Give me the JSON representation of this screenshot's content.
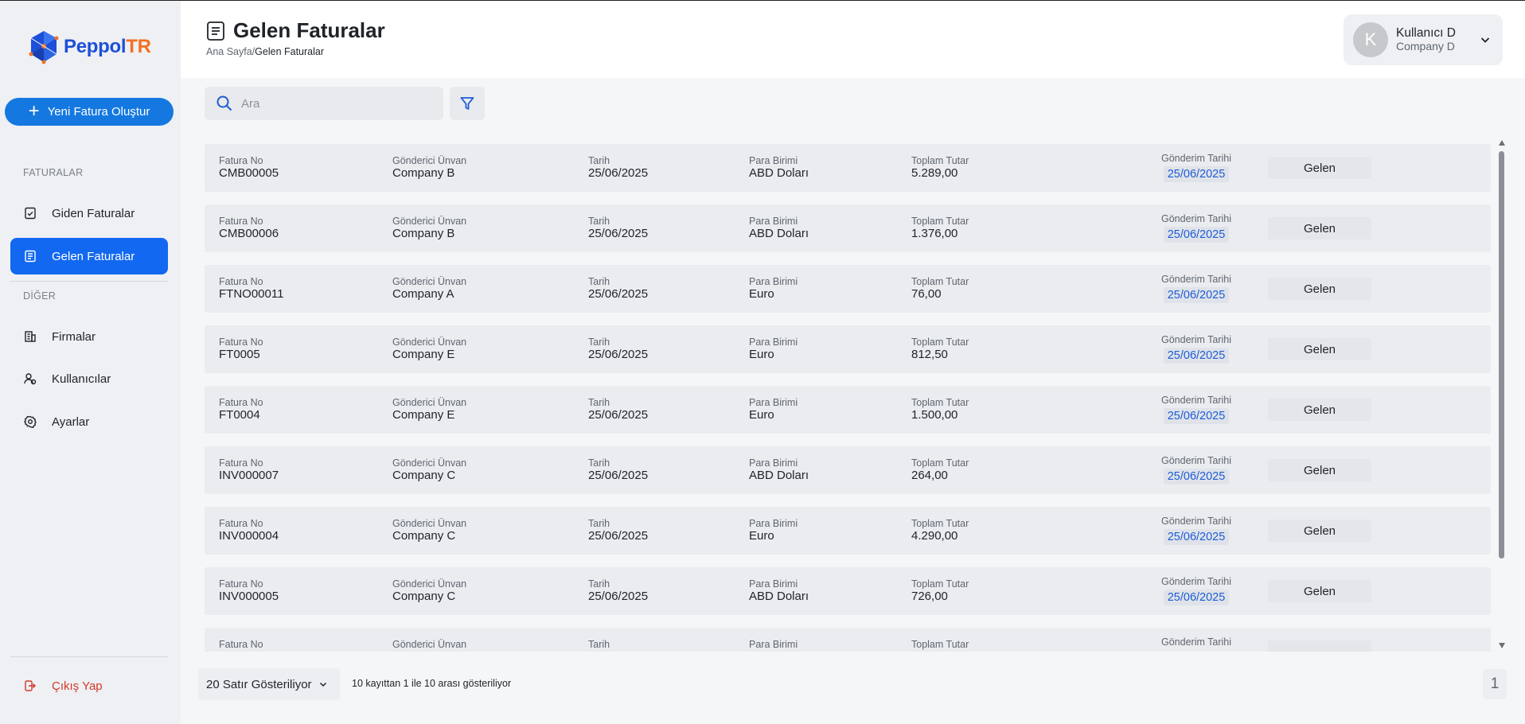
{
  "brand": {
    "part1": "Peppol",
    "part2": "TR",
    "color_blue": "#1d4fd8",
    "color_orange": "#f37021"
  },
  "sidebar": {
    "new_invoice_label": "Yeni Fatura Oluştur",
    "section_invoices": "FATURALAR",
    "section_other": "DİĞER",
    "items": [
      {
        "label": "Giden Faturalar",
        "icon": "outgoing-invoice-icon"
      },
      {
        "label": "Gelen Faturalar",
        "icon": "incoming-invoice-icon",
        "active": true
      },
      {
        "label": "Firmalar",
        "icon": "building-icon"
      },
      {
        "label": "Kullanıcılar",
        "icon": "users-icon"
      },
      {
        "label": "Ayarlar",
        "icon": "gear-icon"
      }
    ],
    "logout_label": "Çıkış Yap"
  },
  "header": {
    "title": "Gelen Faturalar",
    "breadcrumb_home": "Ana Sayfa",
    "breadcrumb_sep": "/",
    "breadcrumb_current": "Gelen Faturalar"
  },
  "user": {
    "initial": "K",
    "name": "Kullanıcı D",
    "company": "Company D"
  },
  "search": {
    "placeholder": "Ara",
    "value": ""
  },
  "columns": {
    "invoice_no": "Fatura No",
    "sender": "Gönderici Ünvan",
    "date": "Tarih",
    "currency": "Para Birimi",
    "total": "Toplam Tutar",
    "send_date": "Gönderim Tarihi"
  },
  "rows": [
    {
      "invoice_no": "CMB00005",
      "sender": "Company B",
      "date": "25/06/2025",
      "currency": "ABD Doları",
      "total": "5.289,00",
      "send_date": "25/06/2025",
      "status": "Gelen"
    },
    {
      "invoice_no": "CMB00006",
      "sender": "Company B",
      "date": "25/06/2025",
      "currency": "ABD Doları",
      "total": "1.376,00",
      "send_date": "25/06/2025",
      "status": "Gelen"
    },
    {
      "invoice_no": "FTNO00011",
      "sender": "Company A",
      "date": "25/06/2025",
      "currency": "Euro",
      "total": "76,00",
      "send_date": "25/06/2025",
      "status": "Gelen"
    },
    {
      "invoice_no": "FT0005",
      "sender": "Company E",
      "date": "25/06/2025",
      "currency": "Euro",
      "total": "812,50",
      "send_date": "25/06/2025",
      "status": "Gelen"
    },
    {
      "invoice_no": "FT0004",
      "sender": "Company E",
      "date": "25/06/2025",
      "currency": "Euro",
      "total": "1.500,00",
      "send_date": "25/06/2025",
      "status": "Gelen"
    },
    {
      "invoice_no": "INV000007",
      "sender": "Company C",
      "date": "25/06/2025",
      "currency": "ABD Doları",
      "total": "264,00",
      "send_date": "25/06/2025",
      "status": "Gelen"
    },
    {
      "invoice_no": "INV000004",
      "sender": "Company C",
      "date": "25/06/2025",
      "currency": "Euro",
      "total": "4.290,00",
      "send_date": "25/06/2025",
      "status": "Gelen"
    },
    {
      "invoice_no": "INV000005",
      "sender": "Company C",
      "date": "25/06/2025",
      "currency": "ABD Doları",
      "total": "726,00",
      "send_date": "25/06/2025",
      "status": "Gelen"
    },
    {
      "invoice_no": "",
      "sender": "",
      "date": "",
      "currency": "",
      "total": "",
      "send_date": "",
      "status": ""
    }
  ],
  "footer": {
    "rows_per_page": "20 Satır Gösteriliyor",
    "record_info": "10 kayıttan 1 ile 10 arası gösteriliyor",
    "page": "1"
  }
}
